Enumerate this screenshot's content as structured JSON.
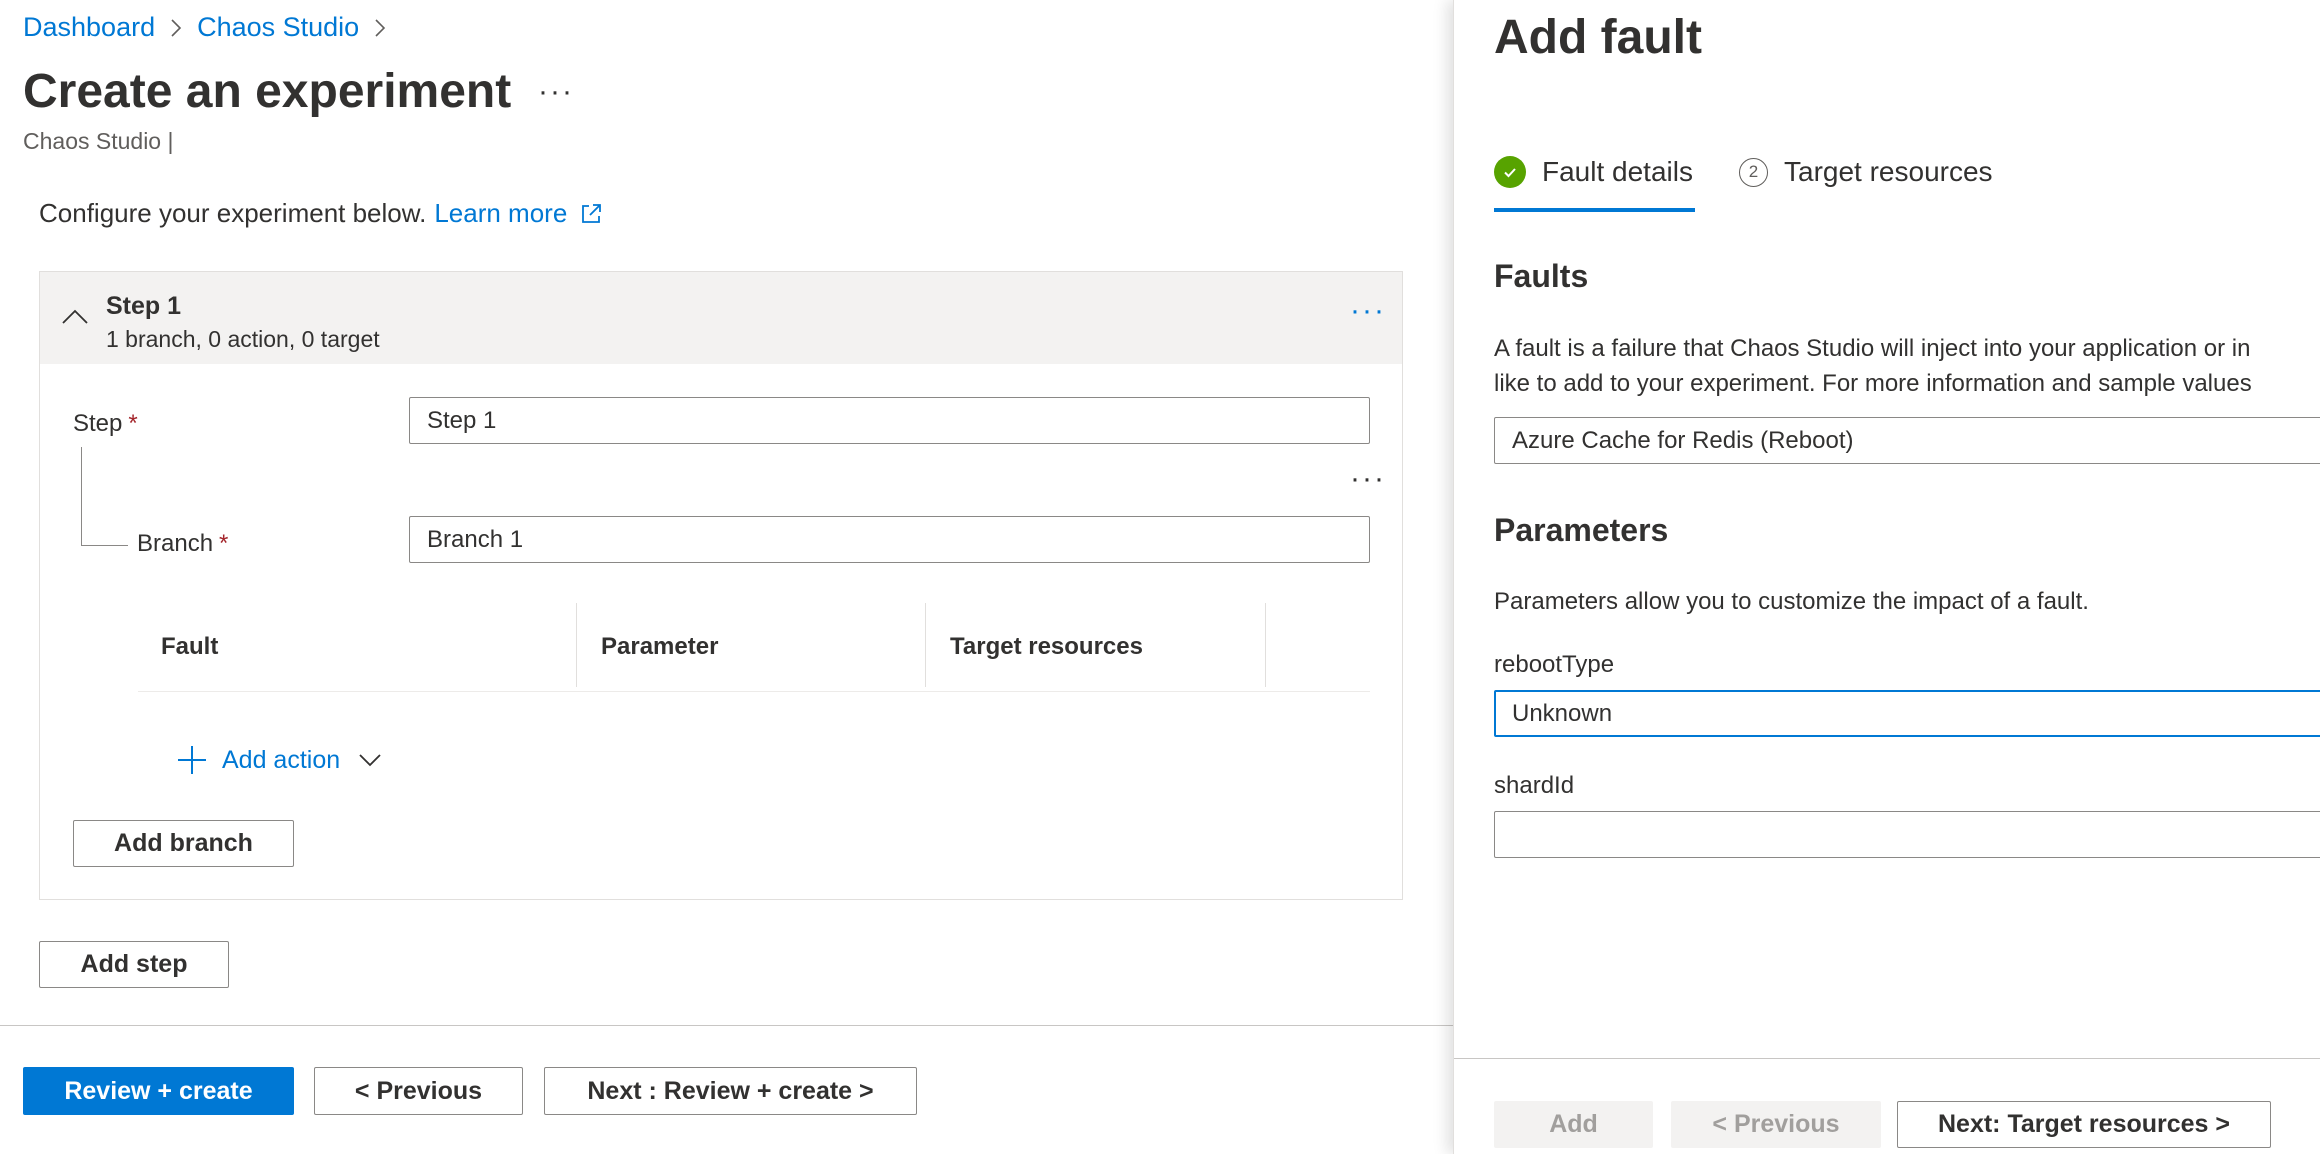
{
  "breadcrumb": [
    {
      "label": "Dashboard"
    },
    {
      "label": "Chaos Studio"
    }
  ],
  "page": {
    "title": "Create an experiment",
    "more_label": "···",
    "subtitle": "Chaos Studio |"
  },
  "intro": {
    "text": "Configure your experiment below.",
    "learn_more": "Learn more"
  },
  "step": {
    "title": "Step 1",
    "summary": "1 branch, 0 action, 0 target",
    "more_label": "···",
    "step_label": "Step",
    "step_value": "Step 1",
    "branch_label": "Branch",
    "branch_value": "Branch 1",
    "branch_more_label": "···",
    "required_mark": "*",
    "columns": [
      "Fault",
      "Parameter",
      "Target resources"
    ],
    "add_action": "Add action",
    "add_branch": "Add branch"
  },
  "add_step": "Add step",
  "footer": {
    "review_create": "Review + create",
    "previous": "< Previous",
    "next": "Next : Review + create >"
  },
  "panel": {
    "title": "Add fault",
    "tabs": [
      {
        "label": "Fault details",
        "number": "",
        "state": "completed"
      },
      {
        "label": "Target resources",
        "number": "2",
        "state": "pending"
      }
    ],
    "faults_heading": "Faults",
    "faults_desc_line1": "A fault is a failure that Chaos Studio will inject into your application or in",
    "faults_desc_line2": "like to add to your experiment. For more information and sample values",
    "fault_selected": "Azure Cache for Redis (Reboot)",
    "parameters_heading": "Parameters",
    "parameters_desc": "Parameters allow you to customize the impact of a fault.",
    "reboot_label": "rebootType",
    "reboot_value": "Unknown",
    "shard_label": "shardId",
    "shard_value": "",
    "buttons": {
      "add": "Add",
      "previous": "< Previous",
      "next": "Next: Target resources >"
    }
  },
  "colors": {
    "accent": "#0078d4",
    "success": "#57a300",
    "required": "#a4262c"
  }
}
